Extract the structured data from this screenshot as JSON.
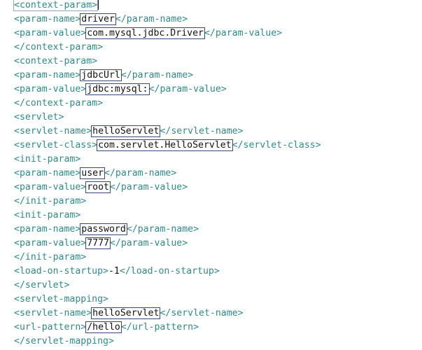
{
  "editor": {
    "lines": [
      {
        "open": "<context-param>",
        "value": "",
        "close": ""
      },
      {
        "open": "<param-name>",
        "value": "driver",
        "close": "</param-name>"
      },
      {
        "open": "<param-value>",
        "value": "com.mysql.jdbc.Driver",
        "close": "</param-value>"
      },
      {
        "open": "</context-param>",
        "value": "",
        "close": ""
      },
      {
        "open": "<context-param>",
        "value": "",
        "close": ""
      },
      {
        "open": "<param-name>",
        "value": "jdbcUrl",
        "close": "</param-name>"
      },
      {
        "open": "<param-value>",
        "value": "jdbc:mysql:",
        "close": "</param-value>"
      },
      {
        "open": "</context-param>",
        "value": "",
        "close": ""
      },
      {
        "open": "<servlet>",
        "value": "",
        "close": ""
      },
      {
        "open": "<servlet-name>",
        "value": "helloServlet",
        "close": "</servlet-name>"
      },
      {
        "open": "<servlet-class>",
        "value": "com.servlet.HelloServlet",
        "close": "</servlet-class>"
      },
      {
        "open": "<init-param>",
        "value": "",
        "close": ""
      },
      {
        "open": "<param-name>",
        "value": "user",
        "close": "</param-name>"
      },
      {
        "open": "<param-value>",
        "value": "root",
        "close": "</param-value>"
      },
      {
        "open": "</init-param>",
        "value": "",
        "close": ""
      },
      {
        "open": "<init-param>",
        "value": "",
        "close": ""
      },
      {
        "open": "<param-name>",
        "value": "password",
        "close": "</param-name>"
      },
      {
        "open": "<param-value>",
        "value": "7777",
        "close": "</param-value>"
      },
      {
        "open": "</init-param>",
        "value": "",
        "close": ""
      },
      {
        "open": "<load-on-startup>",
        "value": "-1",
        "close": "</load-on-startup>"
      },
      {
        "open": "</servlet>",
        "value": "",
        "close": ""
      },
      {
        "open": "<servlet-mapping>",
        "value": "",
        "close": ""
      },
      {
        "open": "<servlet-name>",
        "value": "helloServlet",
        "close": "</servlet-name>"
      },
      {
        "open": "<url-pattern>",
        "value": "/hello",
        "close": "</url-pattern>"
      },
      {
        "open": "</servlet-mapping>",
        "value": "",
        "close": ""
      }
    ]
  },
  "colors": {
    "tag": "#2e8b8b",
    "value": "#111111",
    "highlight_box": "#3a4a7a"
  }
}
